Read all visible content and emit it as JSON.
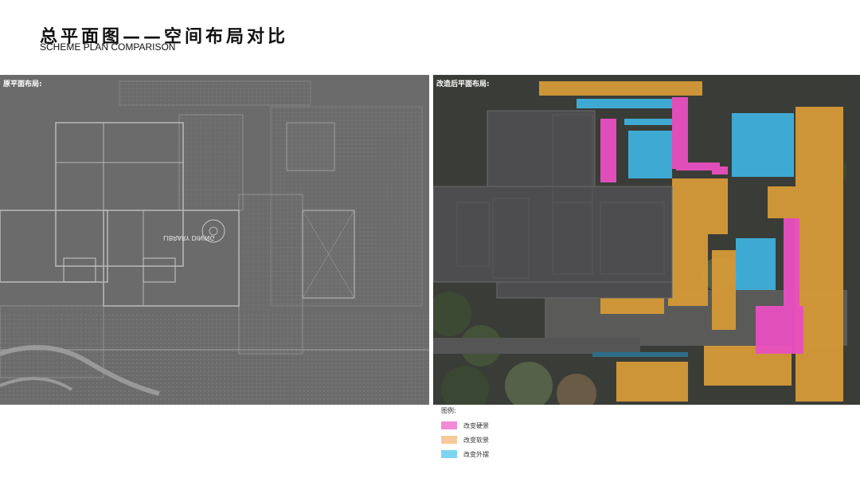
{
  "header": {
    "title_cn": "总平面图——空间布局对比",
    "title_en": "SCHEME PLAN COMPARISON"
  },
  "left_panel": {
    "label": "原平面布局:",
    "plan_text": "LIBRARY DINING"
  },
  "right_panel": {
    "label": "改造后平面布局:"
  },
  "legend": {
    "title": "图例:",
    "items": [
      {
        "label": "改变硬景",
        "color": "#f28ad6"
      },
      {
        "label": "改变软景",
        "color": "#f7c99a"
      },
      {
        "label": "改变外摆",
        "color": "#7fd4f2"
      }
    ]
  }
}
